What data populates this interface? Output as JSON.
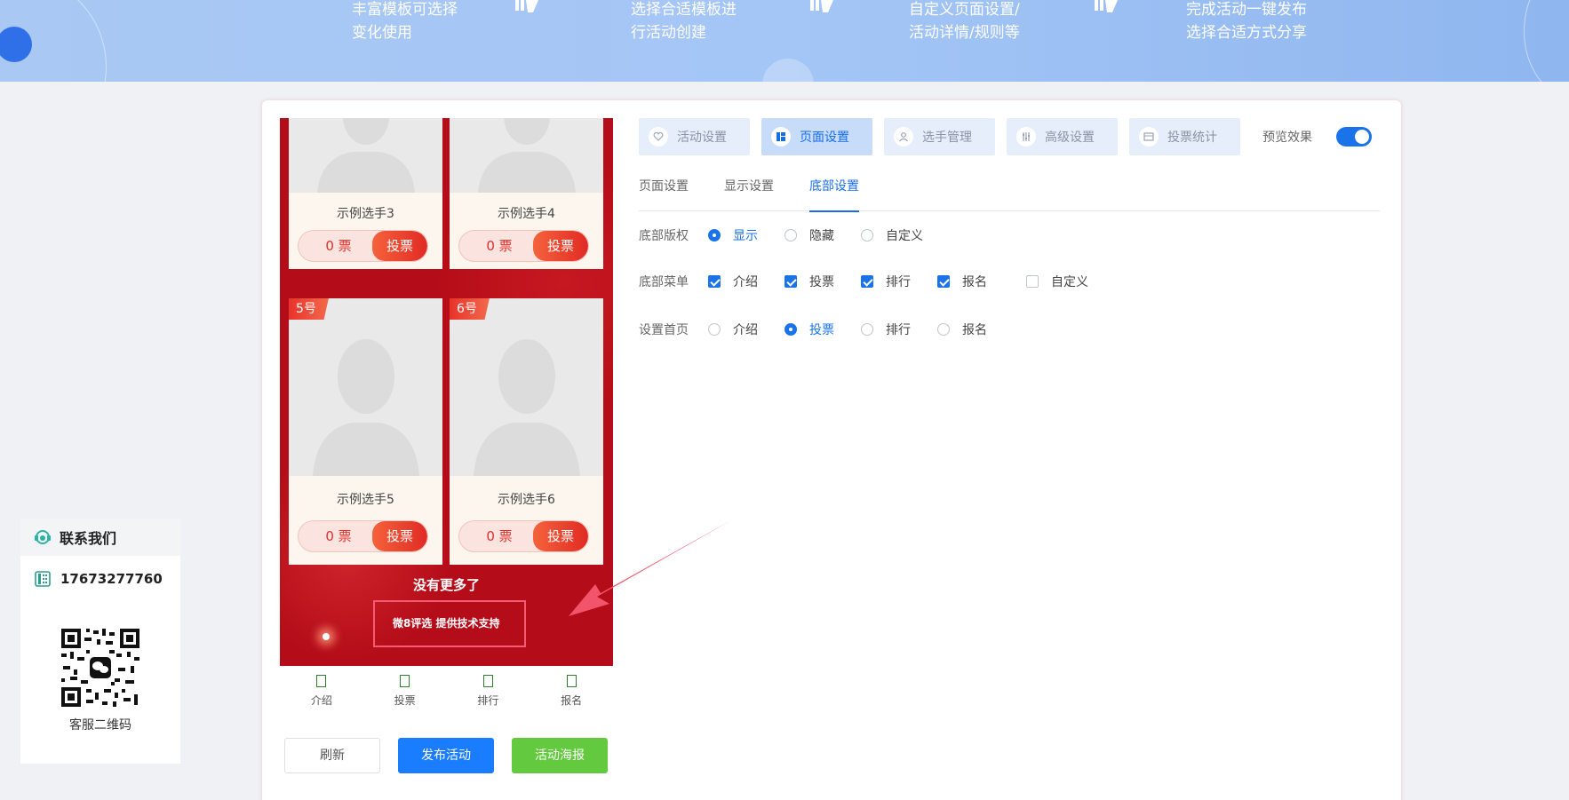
{
  "banner": {
    "steps": [
      {
        "line1": "丰富模板可选择",
        "line2": "变化使用"
      },
      {
        "line1": "选择合适模板进",
        "line2": "行活动创建"
      },
      {
        "line1": "自定义页面设置/",
        "line2": "活动详情/规则等"
      },
      {
        "line1": "完成活动一键发布",
        "line2": "选择合适方式分享"
      }
    ]
  },
  "contact": {
    "title": "联系我们",
    "phone": "17673277760",
    "qr_label": "客服二维码"
  },
  "preview": {
    "players": [
      {
        "name": "示例选手3",
        "votes": "0",
        "vote_unit": "票",
        "vote_button": "投票",
        "badge": ""
      },
      {
        "name": "示例选手4",
        "votes": "0",
        "vote_unit": "票",
        "vote_button": "投票",
        "badge": ""
      },
      {
        "name": "示例选手5",
        "votes": "0",
        "vote_unit": "票",
        "vote_button": "投票",
        "badge": "5号"
      },
      {
        "name": "示例选手6",
        "votes": "0",
        "vote_unit": "票",
        "vote_button": "投票",
        "badge": "6号"
      }
    ],
    "no_more": "没有更多了",
    "tech_support": "微8评选 提供技术支持",
    "nav": [
      {
        "label": "介绍"
      },
      {
        "label": "投票"
      },
      {
        "label": "排行"
      },
      {
        "label": "报名"
      }
    ]
  },
  "actions": {
    "refresh": "刷新",
    "publish": "发布活动",
    "poster": "活动海报"
  },
  "top_tabs": [
    {
      "label": "活动设置",
      "icon": "heart-icon"
    },
    {
      "label": "页面设置",
      "icon": "layout-icon"
    },
    {
      "label": "选手管理",
      "icon": "user-icon"
    },
    {
      "label": "高级设置",
      "icon": "sliders-icon"
    },
    {
      "label": "投票统计",
      "icon": "chart-icon"
    }
  ],
  "top_tabs_active": "页面设置",
  "preview_toggle": {
    "label": "预览效果",
    "on": true
  },
  "sub_tabs": [
    {
      "label": "页面设置"
    },
    {
      "label": "显示设置"
    },
    {
      "label": "底部设置"
    }
  ],
  "sub_tabs_active": "底部设置",
  "form": {
    "copyright": {
      "label": "底部版权",
      "options": [
        "显示",
        "隐藏",
        "自定义"
      ],
      "selected": "显示"
    },
    "menu": {
      "label": "底部菜单",
      "options": [
        "介绍",
        "投票",
        "排行",
        "报名",
        "自定义"
      ],
      "checked": [
        "介绍",
        "投票",
        "排行",
        "报名"
      ]
    },
    "home": {
      "label": "设置首页",
      "options": [
        "介绍",
        "投票",
        "排行",
        "报名"
      ],
      "selected": "投票"
    }
  },
  "colors": {
    "accent": "#1a73e8",
    "phone_bg": "#b40c18",
    "publish": "#1a7cff",
    "poster": "#63c93f"
  }
}
